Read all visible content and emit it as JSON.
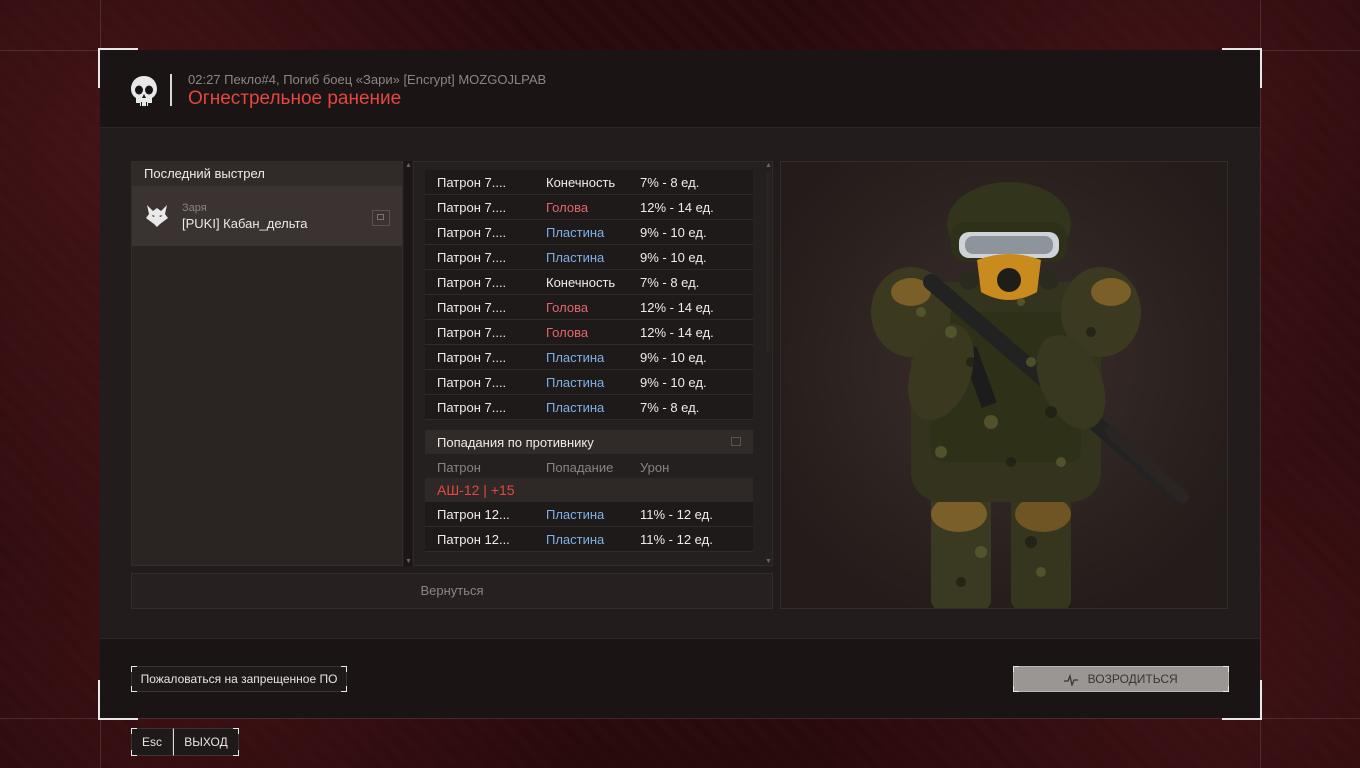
{
  "header": {
    "subtitle": "02:27 Пекло#4, Погиб боец «Зари» [Encrypt] MOZGOJLPAB",
    "title": "Огнестрельное ранение"
  },
  "last_shot": {
    "title": "Последний выстрел",
    "faction": "Заря",
    "killer": "[PUKI] Кабан_дельта"
  },
  "damage_rows": [
    {
      "ammo": "Патрон 7....",
      "zone": "Конечность",
      "zone_type": "limb",
      "damage": "7% - 8 ед."
    },
    {
      "ammo": "Патрон 7....",
      "zone": "Голова",
      "zone_type": "head",
      "damage": "12% - 14 ед."
    },
    {
      "ammo": "Патрон 7....",
      "zone": "Пластина",
      "zone_type": "plate",
      "damage": "9% - 10 ед."
    },
    {
      "ammo": "Патрон 7....",
      "zone": "Пластина",
      "zone_type": "plate",
      "damage": "9% - 10 ед."
    },
    {
      "ammo": "Патрон 7....",
      "zone": "Конечность",
      "zone_type": "limb",
      "damage": "7% - 8 ед."
    },
    {
      "ammo": "Патрон 7....",
      "zone": "Голова",
      "zone_type": "head",
      "damage": "12% - 14 ед."
    },
    {
      "ammo": "Патрон 7....",
      "zone": "Голова",
      "zone_type": "head",
      "damage": "12% - 14 ед."
    },
    {
      "ammo": "Патрон 7....",
      "zone": "Пластина",
      "zone_type": "plate",
      "damage": "9% - 10 ед."
    },
    {
      "ammo": "Патрон 7....",
      "zone": "Пластина",
      "zone_type": "plate",
      "damage": "9% - 10 ед."
    },
    {
      "ammo": "Патрон 7....",
      "zone": "Пластина",
      "zone_type": "plate",
      "damage": "7% - 8 ед."
    }
  ],
  "enemy_hits": {
    "title": "Попадания по противнику",
    "columns": {
      "ammo": "Патрон",
      "hit": "Попадание",
      "damage": "Урон"
    },
    "weapon": "АШ-12 | +15",
    "rows": [
      {
        "ammo": "Патрон 12...",
        "zone": "Пластина",
        "zone_type": "plate",
        "damage": "11% - 12 ед."
      },
      {
        "ammo": "Патрон 12...",
        "zone": "Пластина",
        "zone_type": "plate",
        "damage": "11% - 12 ед."
      }
    ]
  },
  "back_button": "Вернуться",
  "report_button": "Пожаловаться на запрещенное ПО",
  "respawn_button": "ВОЗРОДИТЬСЯ",
  "exit": {
    "key": "Esc",
    "label": "ВЫХОД"
  },
  "colors": {
    "title_red": "#e4473f",
    "head": "#e4656a",
    "plate": "#7fb0e8"
  },
  "icons": {
    "skull": "skull-icon",
    "faction": "wolf-faction-icon",
    "copy": "copy-icon",
    "respawn": "pulse-icon"
  }
}
